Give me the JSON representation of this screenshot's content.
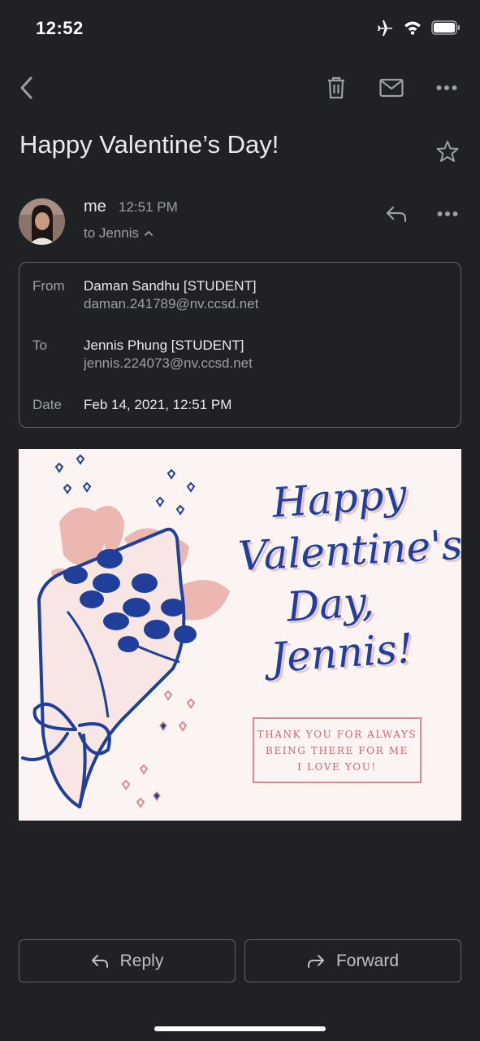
{
  "status_bar": {
    "time": "12:52",
    "icons": [
      "airplane-icon",
      "wifi-icon",
      "battery-icon"
    ]
  },
  "toolbar": {
    "icons": [
      "back-icon",
      "trash-icon",
      "mail-icon",
      "more-icon"
    ]
  },
  "email": {
    "subject": "Happy Valentine’s Day!",
    "sender": "me",
    "time": "12:51 PM",
    "to_line": "to Jennis",
    "details": {
      "from_label": "From",
      "from_name": "Daman Sandhu [STUDENT]",
      "from_email": "daman.241789@nv.ccsd.net",
      "to_label": "To",
      "to_name": "Jennis Phung [STUDENT]",
      "to_email": "jennis.224073@nv.ccsd.net",
      "date_label": "Date",
      "date_value": "Feb 14, 2021, 12:51 PM"
    }
  },
  "card": {
    "title_lines": [
      "Happy",
      "Valentine's",
      "Day,",
      "Jennis!"
    ],
    "message_lines": [
      "THANK YOU FOR ALWAYS",
      "BEING THERE FOR ME",
      "I LOVE YOU!"
    ]
  },
  "actions": {
    "reply": "Reply",
    "forward": "Forward"
  },
  "colors": {
    "background": "#202124",
    "card_blue": "#1f3f9a",
    "card_pink": "#e9b4ae",
    "card_bg": "#fbf4f3"
  }
}
